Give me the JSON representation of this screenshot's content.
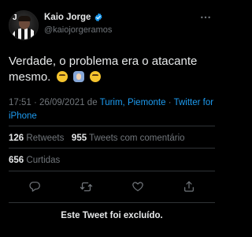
{
  "author": {
    "display_name": "Kaio Jorge",
    "handle": "@kaiojorgeramos",
    "verified_icon": "verified-badge-icon",
    "avatar_icon": "avatar",
    "colors": {
      "verified": "#1d9bf0"
    }
  },
  "tweet": {
    "text": "Verdade, o problema era o atacante mesmo.",
    "emojis": [
      "rolling-on-floor-laughing-emoji",
      "shrugging-person-emoji",
      "zipper-mouth-face-emoji"
    ]
  },
  "meta": {
    "time": "17:51",
    "dot": "·",
    "date": "26/09/2021",
    "location_prefix": "de",
    "location": "Turim, Piemonte",
    "source": "Twitter for iPhone"
  },
  "stats": {
    "retweets_count": "126",
    "retweets_label": "Retweets",
    "quotes_count": "955",
    "quotes_label": "Tweets com comentário",
    "likes_count": "656",
    "likes_label": "Curtidas"
  },
  "actions": {
    "reply_icon": "reply-icon",
    "retweet_icon": "retweet-icon",
    "like_icon": "heart-icon",
    "share_icon": "share-icon"
  },
  "notice": {
    "deleted_text": "Este Tweet foi excluído."
  },
  "colors": {
    "background": "#000000",
    "text": "#e7e9ea",
    "secondary": "#71767b",
    "link": "#1d9bf0",
    "divider": "#2f3336"
  }
}
